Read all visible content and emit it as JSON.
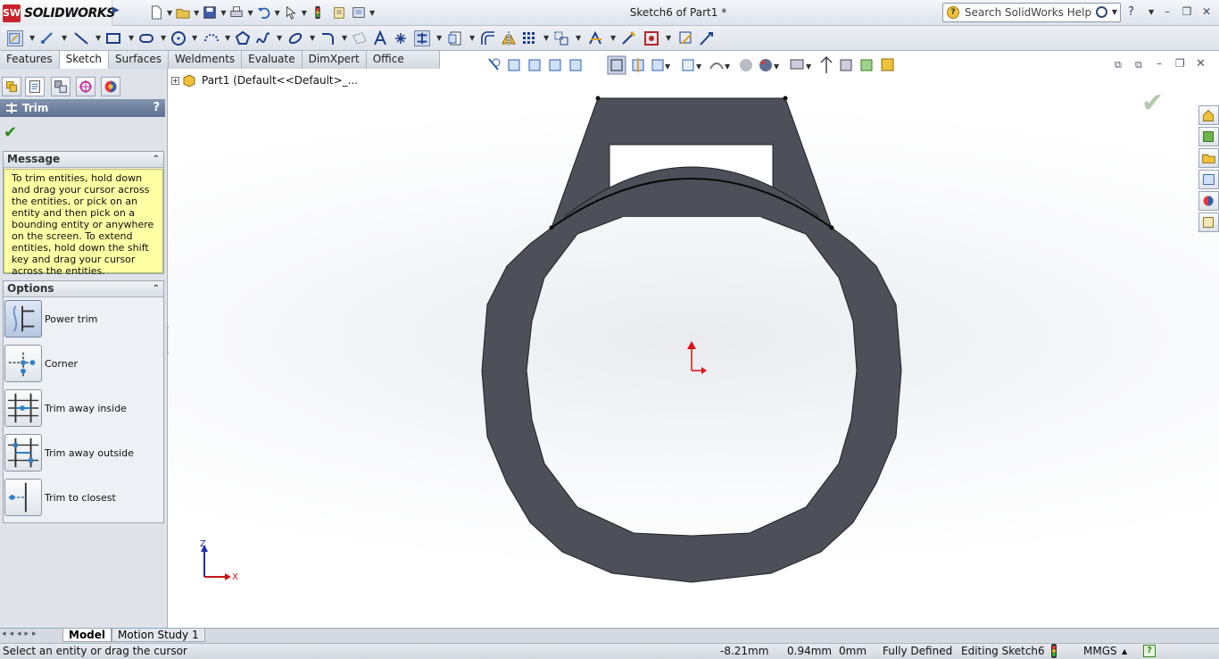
{
  "app": {
    "brand": "SOLIDWORKS",
    "document_title": "Sketch6 of Part1 *"
  },
  "search": {
    "placeholder": "Search SolidWorks Help"
  },
  "window_controls": {
    "help": "?",
    "minimize": "–",
    "restore": "❐",
    "close": "✕"
  },
  "tabs": [
    {
      "label": "Features"
    },
    {
      "label": "Sketch",
      "active": true
    },
    {
      "label": "Surfaces"
    },
    {
      "label": "Weldments"
    },
    {
      "label": "Evaluate"
    },
    {
      "label": "DimXpert"
    },
    {
      "label": "Office Products"
    }
  ],
  "property_manager": {
    "title": "Trim",
    "help": "?",
    "message_group": {
      "title": "Message",
      "text": "To trim entities, hold down and drag your cursor across the entities, or pick on an entity and then pick on a bounding entity or anywhere on the screen.  To extend entities, hold down the shift key and drag your cursor across the entities."
    },
    "options_group": {
      "title": "Options",
      "items": [
        {
          "label": "Power trim",
          "selected": true
        },
        {
          "label": "Corner"
        },
        {
          "label": "Trim away inside"
        },
        {
          "label": "Trim away outside"
        },
        {
          "label": "Trim to closest"
        }
      ]
    }
  },
  "feature_tree": {
    "root": "Part1  (Default<<Default>_..."
  },
  "triad": {
    "z": "Z",
    "x": "X"
  },
  "bottom_tabs": [
    {
      "label": "Model",
      "active": true
    },
    {
      "label": "Motion Study 1"
    }
  ],
  "status_bar": {
    "hint": "Select an entity or drag the cursor",
    "x": "-8.21mm",
    "y": "0.94mm",
    "z": "0mm",
    "sketch_state": "Fully Defined",
    "editing": "Editing Sketch6",
    "units": "MMGS",
    "units_arrow": "▲",
    "help": "?"
  },
  "colors": {
    "accent": "#5f7192",
    "sketch_fill": "#4d5059",
    "message_bg": "#ffffa4",
    "ok": "#2f8a1d"
  }
}
